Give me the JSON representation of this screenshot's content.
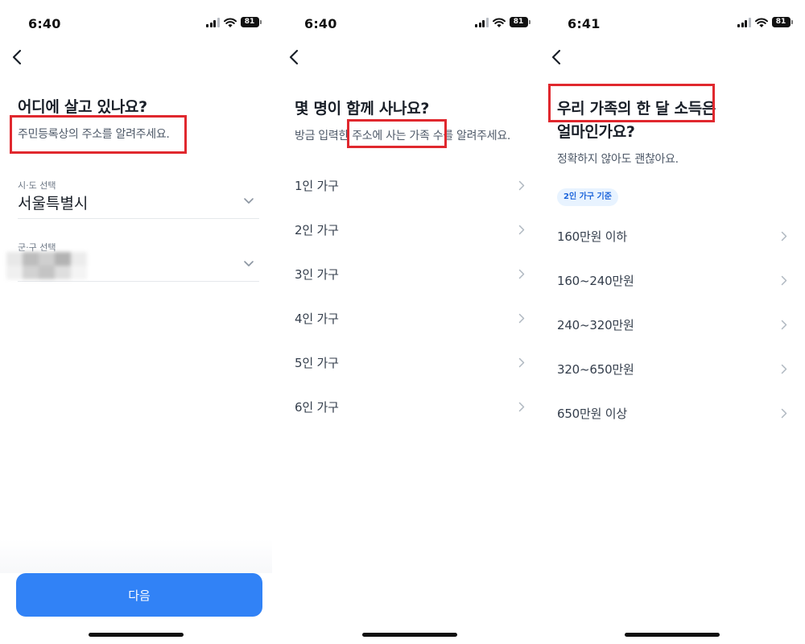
{
  "colors": {
    "primary_button": "#3182f6",
    "highlight_box": "#e0282e",
    "chip_background": "#e8f3ff",
    "chip_text": "#1b64da"
  },
  "screens": [
    {
      "status_bar": {
        "time": "6:40",
        "battery": "81"
      },
      "back_icon": "chevron-left-icon",
      "title": "어디에 살고 있나요?",
      "subtitle": "주민등록상의 주소를 알려주세요.",
      "fields": [
        {
          "label": "시·도 선택",
          "value": "서울특별시",
          "icon": "chevron-down-icon"
        },
        {
          "label": "군·구 선택",
          "value": "",
          "icon": "chevron-down-icon"
        }
      ],
      "next_button": "다음"
    },
    {
      "status_bar": {
        "time": "6:40",
        "battery": "81"
      },
      "back_icon": "chevron-left-icon",
      "title": "몇 명이 함께 사나요?",
      "subtitle": "방금 입력한 주소에 사는 가족 수를 알려주세요.",
      "options": [
        "1인 가구",
        "2인 가구",
        "3인 가구",
        "4인 가구",
        "5인 가구",
        "6인 가구"
      ]
    },
    {
      "status_bar": {
        "time": "6:41",
        "battery": "81"
      },
      "back_icon": "chevron-left-icon",
      "title_line1": "우리 가족의 한 달 소득은",
      "title_line2": "얼마인가요?",
      "subtitle": "정확하지 않아도 괜찮아요.",
      "chip": "2인 가구 기준",
      "options": [
        "160만원 이하",
        "160~240만원",
        "240~320만원",
        "320~650만원",
        "650만원 이상"
      ]
    }
  ]
}
